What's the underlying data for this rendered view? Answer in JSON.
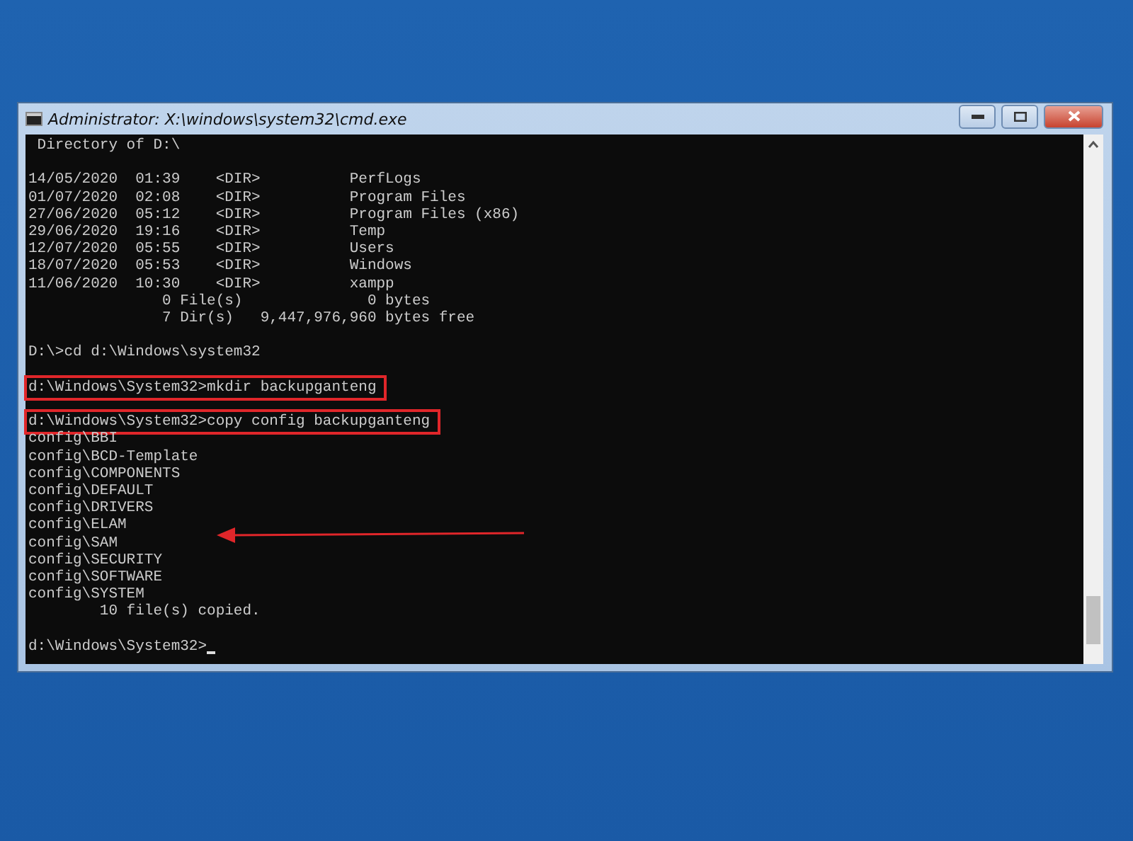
{
  "window": {
    "title": "Administrator: X:\\windows\\system32\\cmd.exe"
  },
  "console": {
    "lines": [
      {
        "text": " Directory of D:\\",
        "boxed": false,
        "gap_before": false
      },
      {
        "text": "14/05/2020  01:39    <DIR>          PerfLogs",
        "boxed": false,
        "gap_before": true
      },
      {
        "text": "01/07/2020  02:08    <DIR>          Program Files",
        "boxed": false,
        "gap_before": false
      },
      {
        "text": "27/06/2020  05:12    <DIR>          Program Files (x86)",
        "boxed": false,
        "gap_before": false
      },
      {
        "text": "29/06/2020  19:16    <DIR>          Temp",
        "boxed": false,
        "gap_before": false
      },
      {
        "text": "12/07/2020  05:55    <DIR>          Users",
        "boxed": false,
        "gap_before": false
      },
      {
        "text": "18/07/2020  05:53    <DIR>          Windows",
        "boxed": false,
        "gap_before": false
      },
      {
        "text": "11/06/2020  10:30    <DIR>          xampp",
        "boxed": false,
        "gap_before": false
      },
      {
        "text": "               0 File(s)              0 bytes",
        "boxed": false,
        "gap_before": false
      },
      {
        "text": "               7 Dir(s)   9,447,976,960 bytes free",
        "boxed": false,
        "gap_before": false
      },
      {
        "text": "D:\\>cd d:\\Windows\\system32",
        "boxed": false,
        "gap_before": true
      },
      {
        "text": "d:\\Windows\\System32>mkdir backupganteng",
        "boxed": true,
        "gap_before": true
      },
      {
        "text": "d:\\Windows\\System32>copy config backupganteng",
        "boxed": true,
        "gap_before": true
      },
      {
        "text": "config\\BBI",
        "boxed": false,
        "gap_before": false
      },
      {
        "text": "config\\BCD-Template",
        "boxed": false,
        "gap_before": false
      },
      {
        "text": "config\\COMPONENTS",
        "boxed": false,
        "gap_before": false
      },
      {
        "text": "config\\DEFAULT",
        "boxed": false,
        "gap_before": false
      },
      {
        "text": "config\\DRIVERS",
        "boxed": false,
        "gap_before": false
      },
      {
        "text": "config\\ELAM",
        "boxed": false,
        "gap_before": false
      },
      {
        "text": "config\\SAM",
        "boxed": false,
        "gap_before": false
      },
      {
        "text": "config\\SECURITY",
        "boxed": false,
        "gap_before": false
      },
      {
        "text": "config\\SOFTWARE",
        "boxed": false,
        "gap_before": false
      },
      {
        "text": "config\\SYSTEM",
        "boxed": false,
        "gap_before": false
      },
      {
        "text": "        10 file(s) copied.",
        "boxed": false,
        "gap_before": false
      },
      {
        "text": "d:\\Windows\\System32>",
        "boxed": false,
        "gap_before": true,
        "cursor": true
      }
    ]
  }
}
